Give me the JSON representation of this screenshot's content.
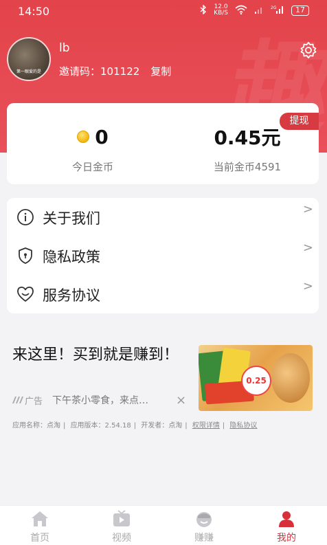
{
  "status_bar": {
    "time": "14:50",
    "speed_value": "12.0",
    "speed_unit": "KB/S",
    "battery": "17"
  },
  "profile": {
    "username": "lb",
    "invite_label": "邀请码：",
    "invite_code": "101122",
    "copy_label": "复制",
    "avatar_caption": "第一眼爱的是"
  },
  "wallet": {
    "withdraw_label": "提现",
    "today_coins_value": "0",
    "today_coins_label": "今日金币",
    "balance_value": "0.45元",
    "current_coins_label": "当前金币4591"
  },
  "menu": {
    "items": [
      {
        "label": "关于我们",
        "icon": "info-icon"
      },
      {
        "label": "隐私政策",
        "icon": "shield-lock-icon"
      },
      {
        "label": "服务协议",
        "icon": "heart-smile-icon"
      }
    ],
    "chevron": ">"
  },
  "ad": {
    "headline": "来这里！买到就是赚到！",
    "ad_tag": "广告",
    "description": "下午茶小零食，来点…",
    "close": "×",
    "app_name": "应用名称：点淘",
    "app_version": "应用版本：2.54.18",
    "developer": "开发者：点淘",
    "permissions_link": "权限详情",
    "privacy_link": "隐私协议",
    "image_price": "0.25"
  },
  "tabbar": {
    "tabs": [
      {
        "label": "首页",
        "icon": "home-icon",
        "active": false
      },
      {
        "label": "视频",
        "icon": "video-icon",
        "active": false
      },
      {
        "label": "赚赚",
        "icon": "earn-icon",
        "active": false
      },
      {
        "label": "我的",
        "icon": "profile-icon",
        "active": true
      }
    ]
  },
  "colors": {
    "brand_red": "#e3434a",
    "active_tab": "#d8303a",
    "withdraw_bg": "#d73a40"
  }
}
